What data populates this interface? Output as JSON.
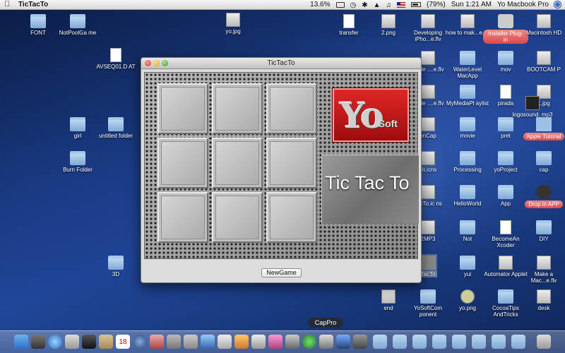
{
  "menubar": {
    "app_name": "TicTacTo",
    "percent": "13.6%",
    "battery": "(79%)",
    "clock": "Sun 1:21 AM",
    "user": "Yo Macbook Pro"
  },
  "window": {
    "title": "TicTacTo",
    "banner_text": "Tic Tac To",
    "logo_big": "Yo",
    "logo_small": "Soft",
    "new_game_label": "NewGame"
  },
  "board": [
    "",
    "",
    "",
    "",
    "",
    "",
    "",
    "",
    ""
  ],
  "desktop_icons": {
    "font": "FONT",
    "notpoolgame": "NotPoolGa me",
    "yo_jpg": "yo.jpg",
    "transfer": "transfer",
    "two_png": "2.png",
    "developing": "Developing iPho...e.flv",
    "howto": "how to mak...e.flv",
    "installer": "Installer Plug-in",
    "macintosh": "Macintosh HD",
    "avseq": "AVSEQ01.D AT",
    "code1": "Code ....e.flv",
    "waterlevel": "WaterLevel MacApp",
    "mov": "mov",
    "bootcamp": "BOOTCAM P",
    "code2": "Code ....e.flv",
    "mymedia": "MyMediaPl aylist",
    "pirada": "pirada",
    "one_jpg": "1.jpg",
    "logosound": "logosound. mp3",
    "girl": "girl",
    "untitled": "untitled folder",
    "encap": "enCap",
    "movie": "movie",
    "pret": "pret",
    "apple_tutorial": "Apple Tutorial",
    "burn": "Burn Folder",
    "icns": "cit.icns",
    "processing": "Processing",
    "yoproject": "yoProject",
    "cap": "cap",
    "tictacto_icns": "TacTo.ic ns",
    "helloworld": "HelloWorld",
    "app": "App",
    "dropinapp": "Drop in APP",
    "mp3": "2MP3",
    "not": "Not",
    "becomeanx": "BecomeAn Xcoder",
    "diy": "DIY",
    "threed": "3D",
    "tictacto_app": "TacTo",
    "yui": "yui",
    "automator": "Automator Applet",
    "makeamac": "Make a Mac...e.flv",
    "end": "end",
    "yosoftcomp": "YoSoftCom ponent",
    "yo_png": "yo.png",
    "cocoatips": "CocoaTips AndTricks",
    "desk": "desk"
  },
  "dock": {
    "tooltip": "CapPro",
    "calendar_day": "18"
  }
}
